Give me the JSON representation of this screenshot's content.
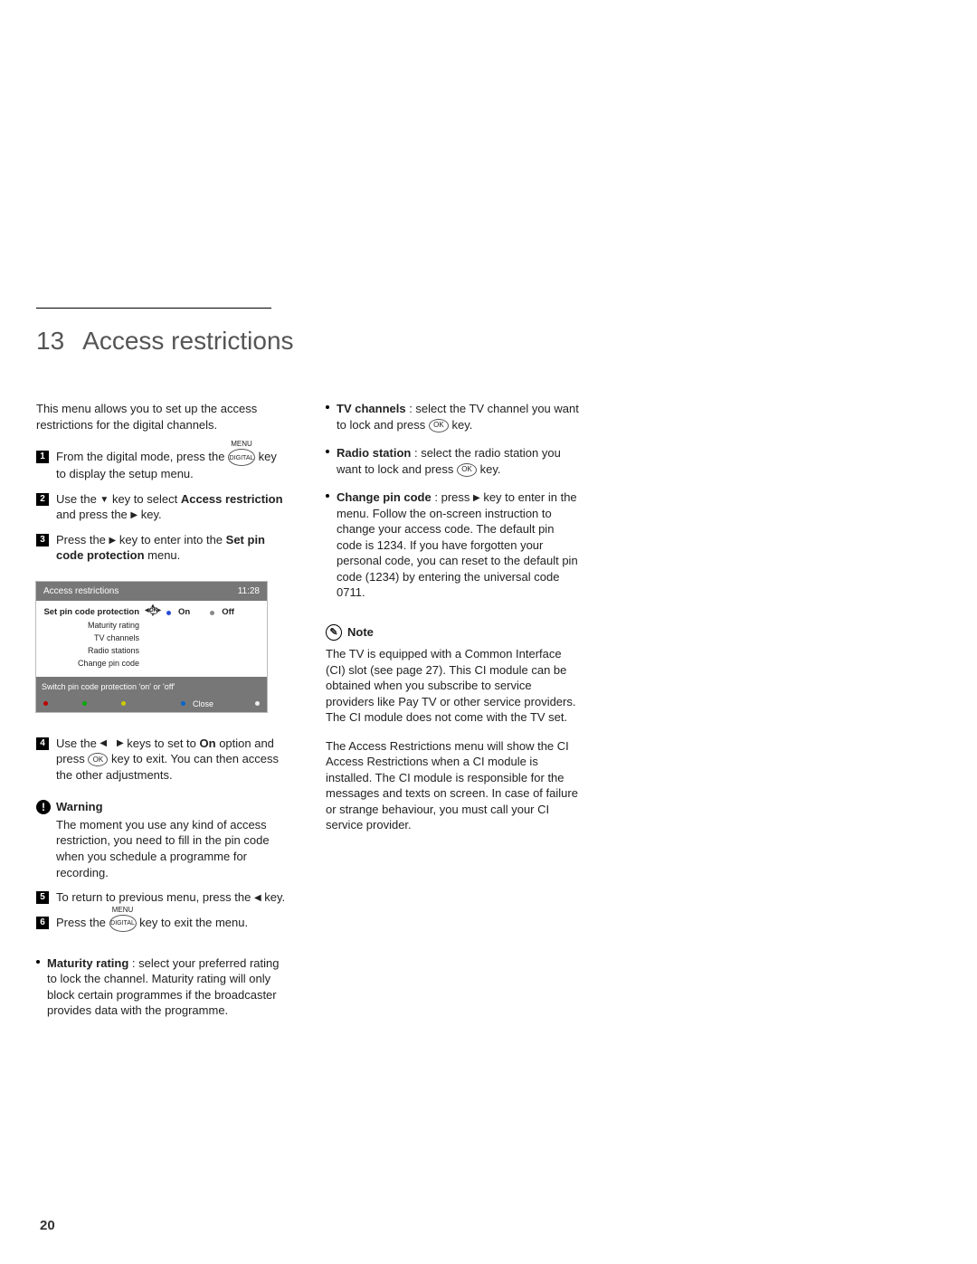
{
  "page_number": "20",
  "section": {
    "number": "13",
    "title": "Access restrictions"
  },
  "left": {
    "intro": "This menu allows you to set up the access restrictions for the digital channels.",
    "step1a": "From the digital mode, press the ",
    "step1b": " key to display the setup menu.",
    "step2a": "Use the ",
    "step2b": " key to select ",
    "step2_bold": "Access restriction",
    "step2c": " and press the ",
    "step2d": " key.",
    "step3a": "Press the ",
    "step3b": " key to enter into the ",
    "step3_bold": "Set pin code protection",
    "step3c": " menu.",
    "step4a": "Use the ",
    "step4b": " keys to set to ",
    "step4_bold": "On",
    "step4c": " option and press ",
    "step4d": " key to exit. You can then access the other adjustments.",
    "warning_label": "Warning",
    "warning_text": "The moment you use any kind of access restriction, you need to fill in the pin code when you schedule a programme for recording.",
    "step5a": "To return to previous menu, press the ",
    "step5b": " key.",
    "step6a": "Press the ",
    "step6b": " key to exit the menu.",
    "maturity_bold": "Maturity rating",
    "maturity_text": " : select your preferred rating to lock the channel. Maturity rating will only block certain programmes if the broadcaster provides data with the programme.",
    "digital_label": "DIGITAL",
    "menu_label": "MENU",
    "ok_label": "OK"
  },
  "tv": {
    "title": "Access restrictions",
    "time": "11:28",
    "items": [
      "Set pin code protection",
      "Maturity rating",
      "TV channels",
      "Radio stations",
      "Change pin code"
    ],
    "on": "On",
    "off": "Off",
    "help": "Switch pin code protection 'on' or 'off'",
    "close": "Close"
  },
  "right": {
    "tv_bold": "TV channels",
    "tv_text": ": select the TV channel you want to lock and press ",
    "tv_text2": " key.",
    "radio_bold": "Radio station",
    "radio_text": ": select the radio station you want to lock and press ",
    "radio_text2": " key.",
    "pin_bold": "Change pin code",
    "pin_text1": ": press ",
    "pin_text2": " key to enter in the menu. Follow the on-screen instruction to change your access code. The default pin code is 1234. If you have forgotten your personal code, you can reset to the default pin code (1234) by entering the universal code 0711.",
    "note_label": "Note",
    "note_para1": "The TV is equipped with a Common Interface (CI) slot (see page 27). This CI module can be obtained when you subscribe to service providers like Pay TV or other service providers. The CI module does not come with the TV set.",
    "note_para2": "The Access Restrictions menu will show the CI Access Restrictions when a CI module is installed. The CI module is responsible for the messages and texts on screen. In case of failure or strange behaviour, you must call your CI service provider."
  }
}
